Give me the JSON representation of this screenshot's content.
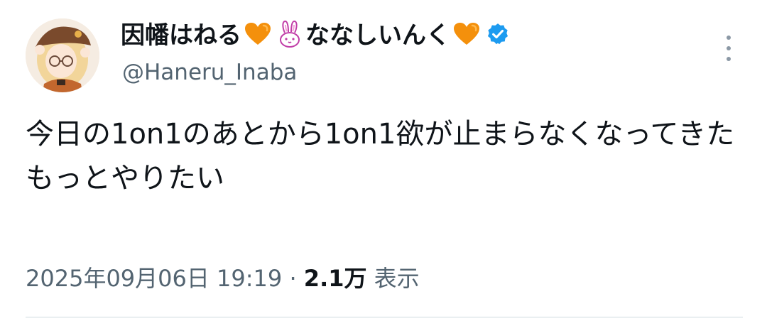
{
  "author": {
    "display_name_part1": "因幡はねる",
    "display_name_part2": "ななしいんく",
    "handle": "@Haneru_Inaba",
    "name_emojis": [
      "orange-heart",
      "rabbit",
      "orange-heart"
    ],
    "verified": true
  },
  "tweet": {
    "text": "今日の1on1のあとから1on1欲が止まらなくなってきた\nもっとやりたい"
  },
  "meta": {
    "timestamp": "2025年09月06日 19:19",
    "separator": "·",
    "views_count": "2.1万",
    "views_label": "表示"
  },
  "colors": {
    "primary_text": "#0f1419",
    "secondary_text": "#536471",
    "verified_blue": "#1d9bf0",
    "orange_heart": "#f4900c",
    "rabbit_pink": "#c13ea8",
    "divider": "#cfd9de"
  }
}
